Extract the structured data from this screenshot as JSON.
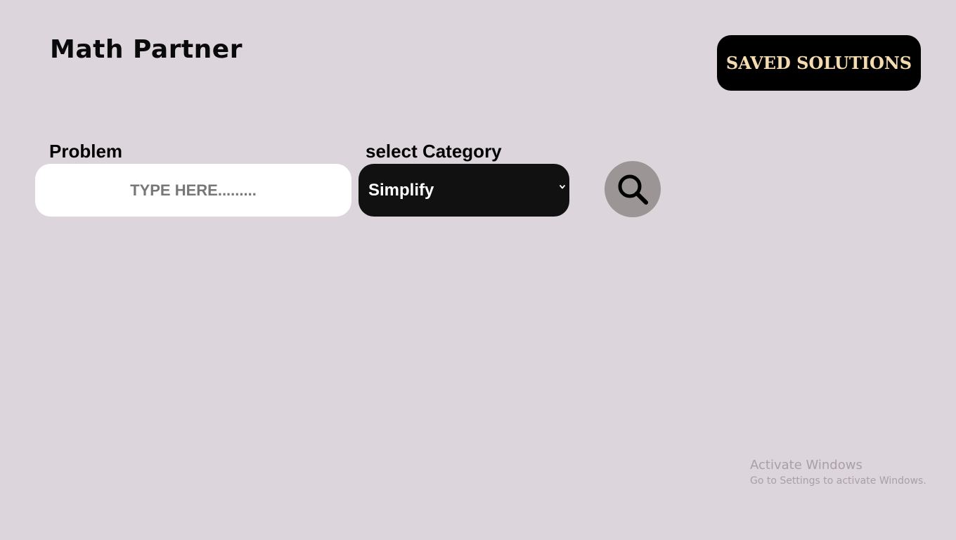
{
  "header": {
    "title": "Math Partner",
    "saved_solutions_label": "SAVED SOLUTIONS"
  },
  "form": {
    "problem_label": "Problem",
    "problem_placeholder": "TYPE HERE.........",
    "problem_value": "",
    "category_label": "select Category",
    "category_selected": "Simplify"
  },
  "search": {
    "icon": "search-icon"
  },
  "watermark": {
    "title": "Activate Windows",
    "subtitle": "Go to Settings to activate Windows."
  },
  "colors": {
    "background": "#dcd5db",
    "button_bg": "#000000",
    "button_text": "#f5dcb0",
    "select_bg": "#111111",
    "search_bg": "#9b9595"
  }
}
